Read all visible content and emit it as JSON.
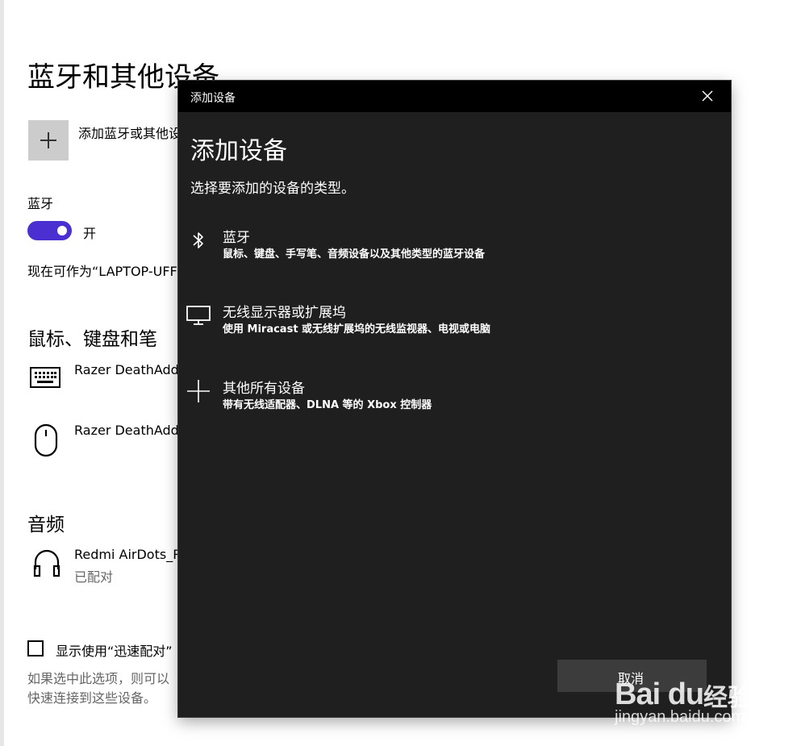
{
  "settings": {
    "title": "蓝牙和其他设备",
    "add_device_label": "添加蓝牙或其他设备",
    "bluetooth_heading": "蓝牙",
    "bluetooth_toggle_state": "开",
    "discoverable_text": "现在可作为“LAPTOP-UFF",
    "mouse_section_title": "鼠标、键盘和笔",
    "devices": [
      {
        "name": "Razer DeathAdder",
        "icon": "keyboard-icon"
      },
      {
        "name": "Razer DeathAdder",
        "icon": "mouse-icon"
      }
    ],
    "audio_section_title": "音频",
    "audio_device": {
      "name": "Redmi AirDots_R",
      "status": "已配对",
      "icon": "headphones-icon"
    },
    "swift_pair_label": "显示使用“迅速配对”",
    "swift_pair_desc_line1": "如果选中此选项，则可以",
    "swift_pair_desc_line2": "快速连接到这些设备。"
  },
  "dialog": {
    "window_title": "添加设备",
    "title": "添加设备",
    "subtitle": "选择要添加的设备的类型。",
    "options": [
      {
        "title": "蓝牙",
        "desc": "鼠标、键盘、手写笔、音频设备以及其他类型的蓝牙设备",
        "icon": "bluetooth-icon"
      },
      {
        "title": "无线显示器或扩展坞",
        "desc": "使用 Miracast 或无线扩展坞的无线监视器、电视或电脑",
        "icon": "monitor-icon"
      },
      {
        "title": "其他所有设备",
        "desc": "带有无线适配器、DLNA 等的 Xbox 控制器",
        "icon": "plus-icon"
      }
    ],
    "cancel_label": "取消"
  },
  "watermark": {
    "brand": "Bai du",
    "cn": "经验",
    "url": "jingyan.baidu.com"
  },
  "colors": {
    "accent": "#4b2fd1",
    "dialog_bg": "#1f1f1f",
    "titlebar_bg": "#000000"
  }
}
